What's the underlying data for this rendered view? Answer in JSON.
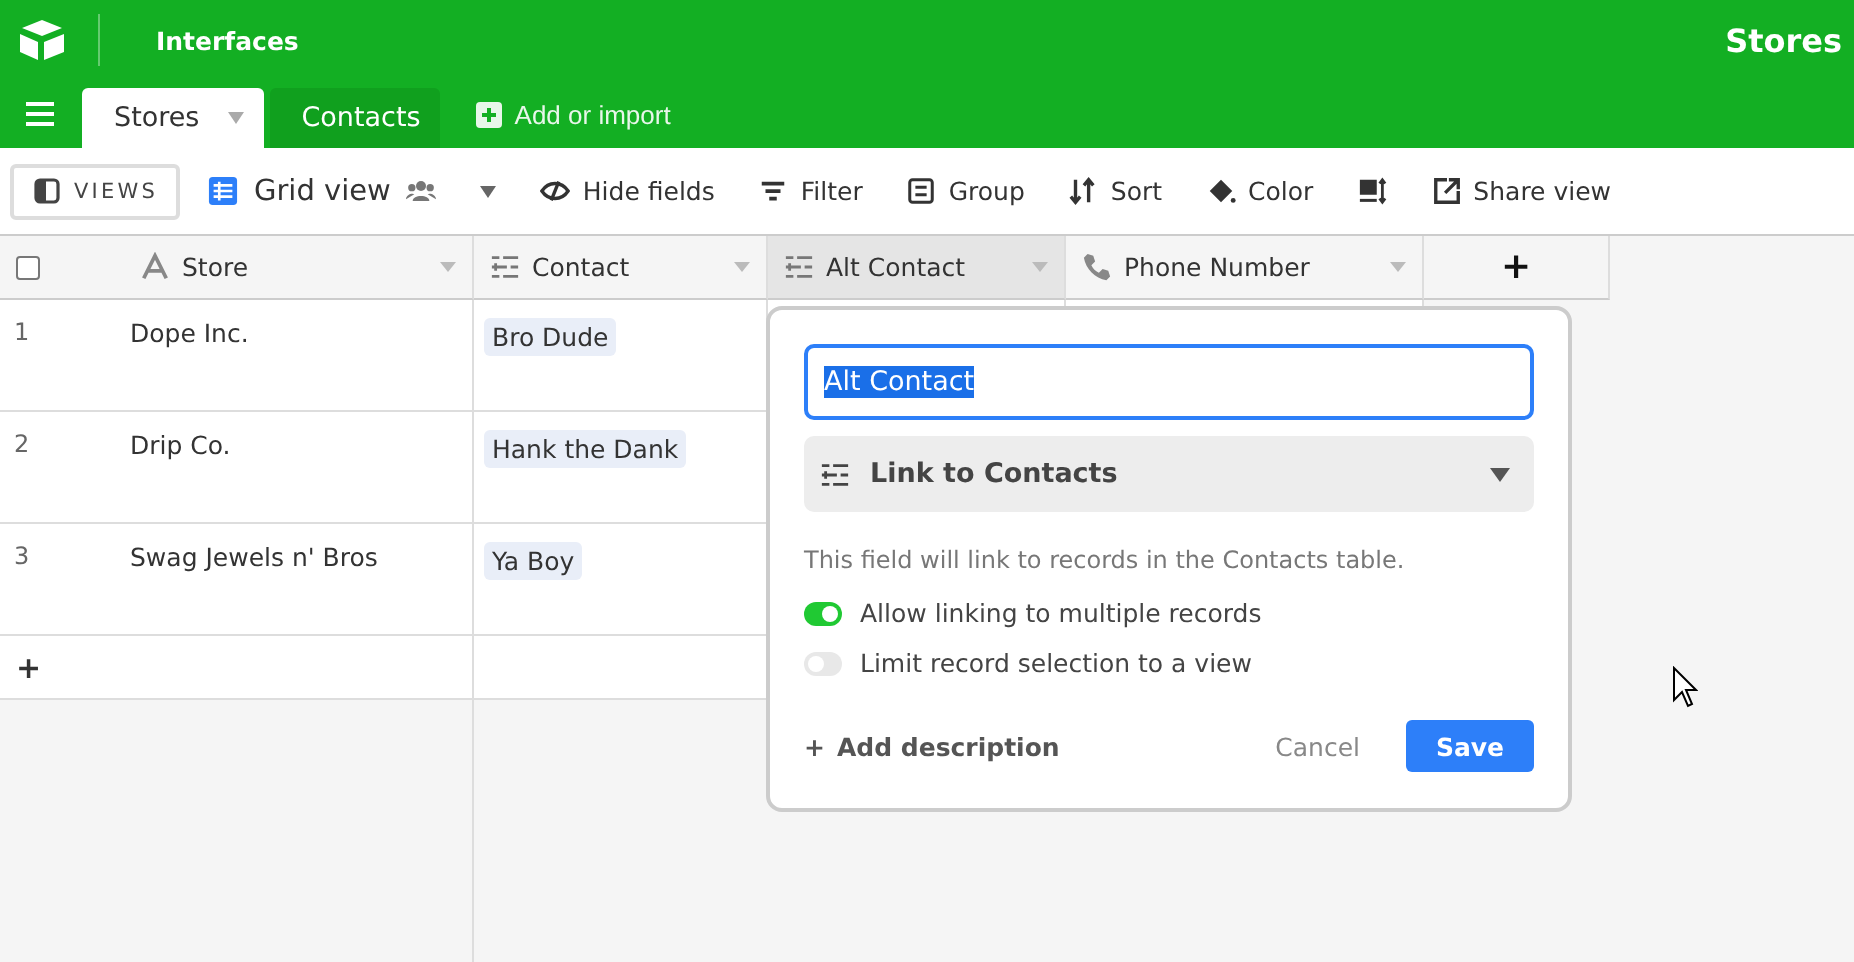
{
  "header": {
    "section": "Interfaces",
    "base_title": "Stores"
  },
  "tabs": [
    {
      "label": "Stores",
      "selected": true
    },
    {
      "label": "Contacts",
      "selected": false
    }
  ],
  "add_table": "Add or import",
  "toolbar": {
    "views_button": "VIEWS",
    "view_name": "Grid view",
    "tools": [
      {
        "kind": "hide",
        "label": "Hide fields"
      },
      {
        "kind": "filter",
        "label": "Filter"
      },
      {
        "kind": "group",
        "label": "Group"
      },
      {
        "kind": "sort",
        "label": "Sort"
      },
      {
        "kind": "color",
        "label": "Color"
      },
      {
        "kind": "row-height"
      },
      {
        "kind": "share",
        "label": "Share view"
      }
    ]
  },
  "table": {
    "columns": [
      {
        "kind": "text",
        "name": "Store",
        "selected": false
      },
      {
        "kind": "link",
        "name": "Contact",
        "selected": false
      },
      {
        "kind": "link",
        "name": "Alt Contact",
        "selected": true
      },
      {
        "kind": "phone",
        "name": "Phone Number",
        "selected": false
      }
    ],
    "add_column": "+",
    "rows": [
      {
        "number": "1",
        "store": "Dope Inc.",
        "contact": "Bro Dude"
      },
      {
        "number": "2",
        "store": "Drip Co.",
        "contact": "Hank the Dank"
      },
      {
        "number": "3",
        "store": "Swag Jewels n' Bros",
        "contact": "Ya Boy"
      }
    ],
    "add_row": "+"
  },
  "field_editor": {
    "name_value": "Alt Contact",
    "field_type": "Link to Contacts",
    "description": "This field will link to records in the Contacts table.",
    "options": [
      {
        "label": "Allow linking to multiple records",
        "on": true
      },
      {
        "label": "Limit record selection to a view",
        "on": false
      }
    ],
    "add_description": "Add description",
    "add_icon": "+",
    "cancel": "Cancel",
    "save": "Save"
  }
}
